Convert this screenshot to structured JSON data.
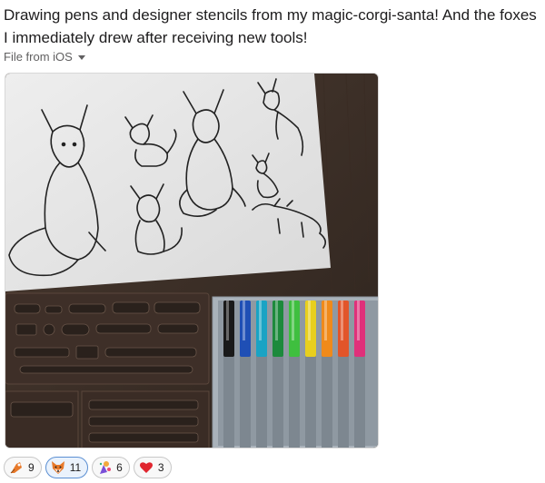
{
  "message": {
    "text": "Drawing pens and designer stencils from my magic-corgi-santa! And the foxes I immediately drew after receiving new tools!",
    "file_source": "File from iOS"
  },
  "photo": {
    "subject": "fox-sketches-with-pens-and-stencils"
  },
  "reactions": [
    {
      "emoji": "fox-paw-icon",
      "count": "9"
    },
    {
      "emoji": "fox-face-icon",
      "count": "11"
    },
    {
      "emoji": "party-fox-icon",
      "count": "6"
    },
    {
      "emoji": "red-heart-icon",
      "count": "3"
    }
  ],
  "colors": {
    "pen_caps": [
      "#1a1a1a",
      "#1f4fb5",
      "#1aa3c4",
      "#1d8a3c",
      "#3fbf3f",
      "#e8cf1e",
      "#f08a1a",
      "#e2552a",
      "#e0307a"
    ],
    "reaction_active_border": "#5b8fd3"
  }
}
